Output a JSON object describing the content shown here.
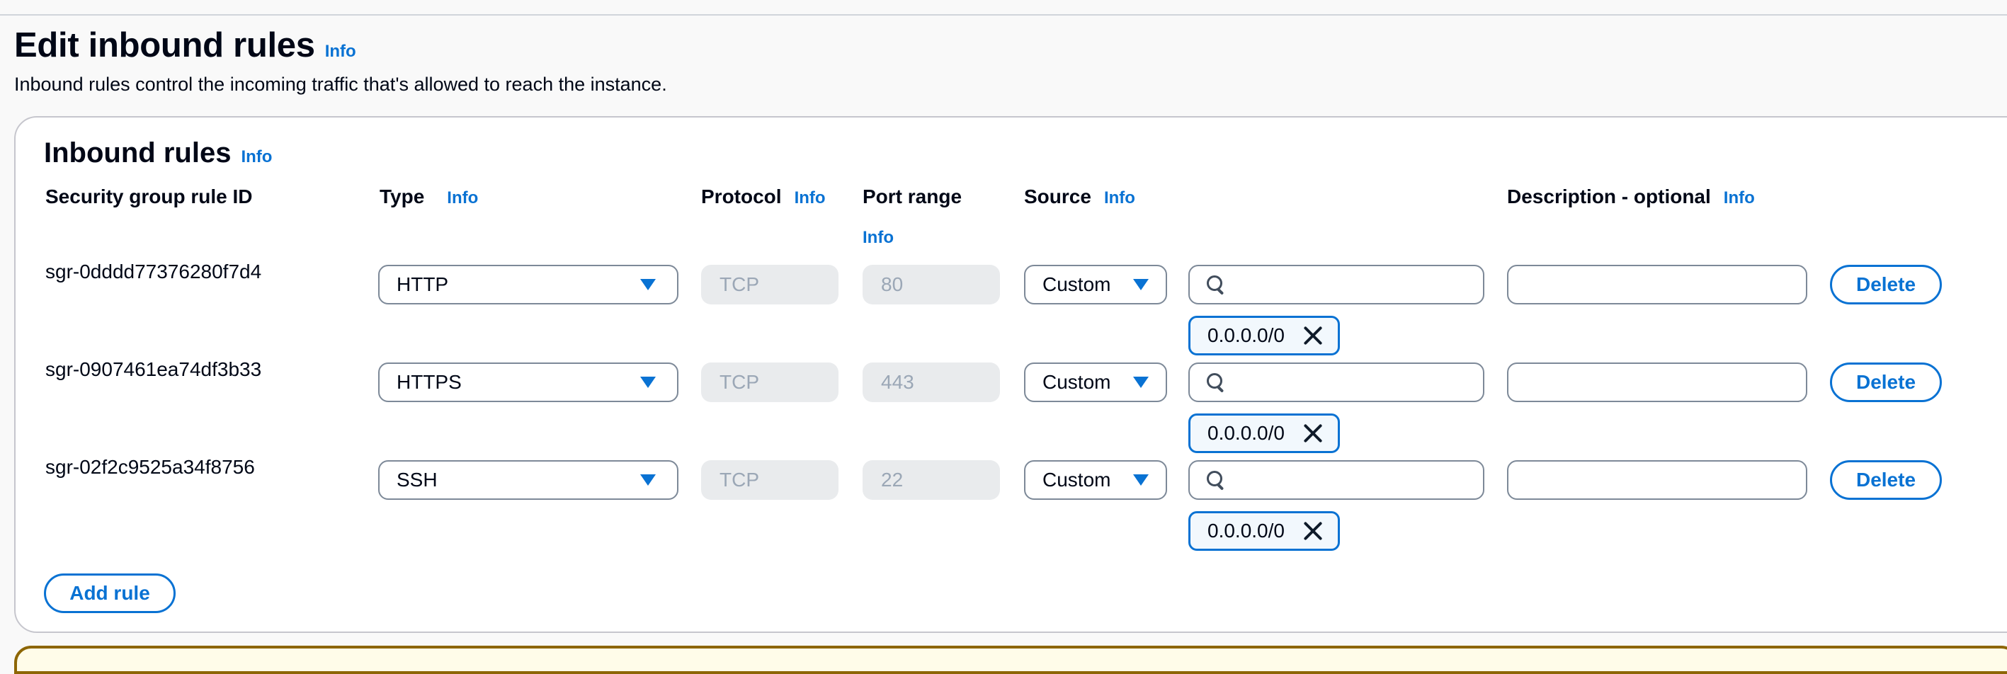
{
  "page": {
    "title": "Edit inbound rules",
    "title_info": "Info",
    "description": "Inbound rules control the incoming traffic that's allowed to reach the instance."
  },
  "panel": {
    "title": "Inbound rules",
    "title_info": "Info",
    "columns": {
      "rule_id": "Security group rule ID",
      "type": "Type",
      "type_info": "Info",
      "protocol": "Protocol",
      "protocol_info": "Info",
      "port_range": "Port range",
      "port_range_info": "Info",
      "source": "Source",
      "source_info": "Info",
      "description": "Description - optional",
      "description_info": "Info"
    },
    "rules": [
      {
        "id": "sgr-0dddd77376280f7d4",
        "type": "HTTP",
        "protocol": "TCP",
        "port": "80",
        "source": "Custom",
        "search_value": "",
        "token": "0.0.0.0/0",
        "description": "",
        "delete_label": "Delete"
      },
      {
        "id": "sgr-0907461ea74df3b33",
        "type": "HTTPS",
        "protocol": "TCP",
        "port": "443",
        "source": "Custom",
        "search_value": "",
        "token": "0.0.0.0/0",
        "description": "",
        "delete_label": "Delete"
      },
      {
        "id": "sgr-02f2c9525a34f8756",
        "type": "SSH",
        "protocol": "TCP",
        "port": "22",
        "source": "Custom",
        "search_value": "",
        "token": "0.0.0.0/0",
        "description": "",
        "delete_label": "Delete"
      }
    ],
    "add_rule_label": "Add rule"
  },
  "colors": {
    "accent": "#0972d3",
    "text": "#000716",
    "disabled_bg": "#e9ebed",
    "disabled_text": "#9ba7b6",
    "warning_border": "#8d6605"
  },
  "icons": {
    "dropdown": "caret-down-icon",
    "search": "search-icon",
    "remove_token": "close-icon"
  }
}
